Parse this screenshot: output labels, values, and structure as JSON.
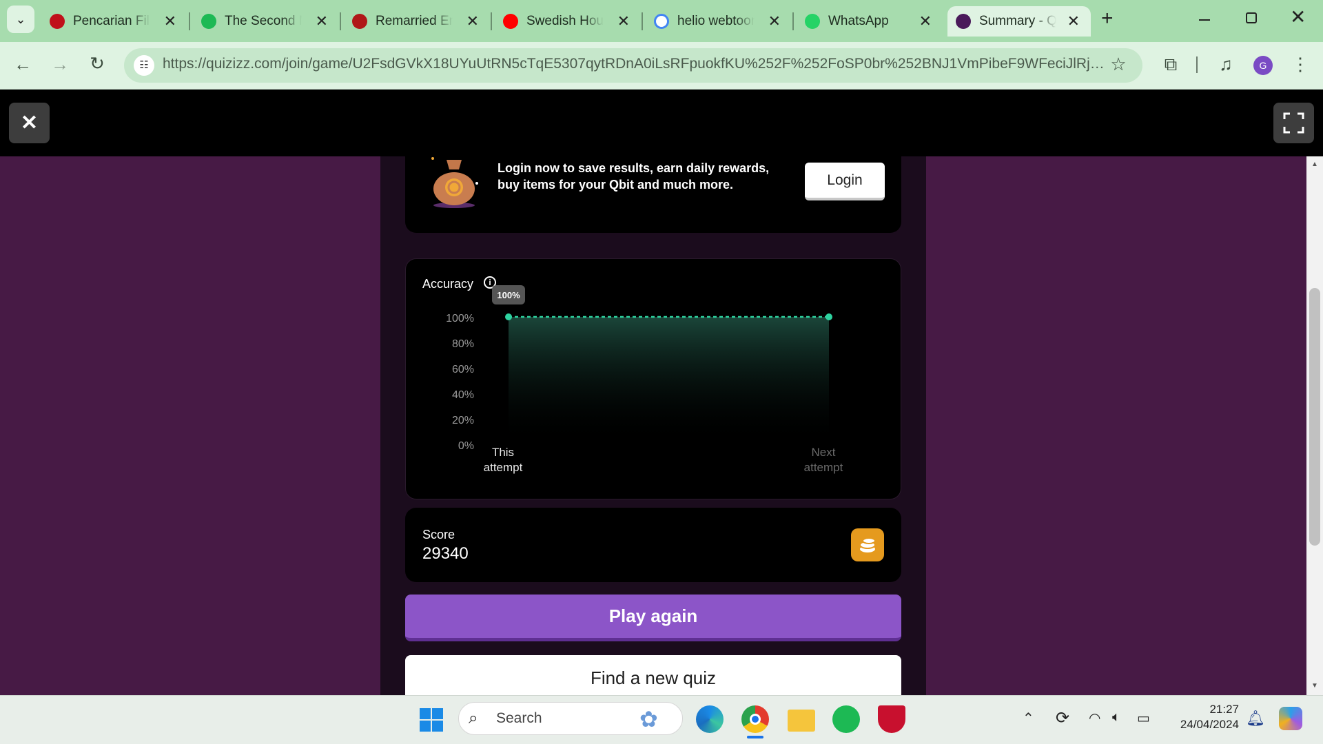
{
  "browser": {
    "tabs": [
      {
        "title": "Pencarian Film",
        "favicon": "site-icon"
      },
      {
        "title": "The Second Marriage",
        "favicon": "leaf-icon"
      },
      {
        "title": "Remarried Empress",
        "favicon": "m-logo-icon"
      },
      {
        "title": "Swedish House",
        "favicon": "youtube-icon"
      },
      {
        "title": "helio webtoon",
        "favicon": "google-icon"
      },
      {
        "title": "WhatsApp",
        "favicon": "whatsapp-icon"
      },
      {
        "title": "Summary - Quizizz",
        "favicon": "quizizz-icon",
        "active": true
      }
    ],
    "url": "https://quizizz.com/join/game/U2FsdGVkX18UYuUtRN5cTqE5307qytRDnA0iLsRFpuokfKU%252F%252FoSP0br%252BNJ1VmPibeF9WFeciJlRjZBeuq...",
    "profile_initial": "G",
    "accent": "#a7dcae"
  },
  "quiz": {
    "login_promo": "Login now to save results, earn daily rewards, buy items for your Qbit and much more.",
    "login_button": "Login",
    "accuracy_title": "Accuracy",
    "score_label": "Score",
    "score_value": "29340",
    "play_again": "Play again",
    "find_quiz": "Find a new quiz"
  },
  "chart_data": {
    "type": "area",
    "title": "Accuracy",
    "categories": [
      "This attempt",
      "Next attempt"
    ],
    "values": [
      100,
      100
    ],
    "yticks": [
      "100%",
      "80%",
      "60%",
      "40%",
      "20%",
      "0%"
    ],
    "ylim": [
      0,
      100
    ],
    "tooltip": "100%",
    "line_color": "#2ed3a0",
    "grid": false
  },
  "taskbar": {
    "search_placeholder": "Search",
    "time": "21:27",
    "date": "24/04/2024"
  }
}
